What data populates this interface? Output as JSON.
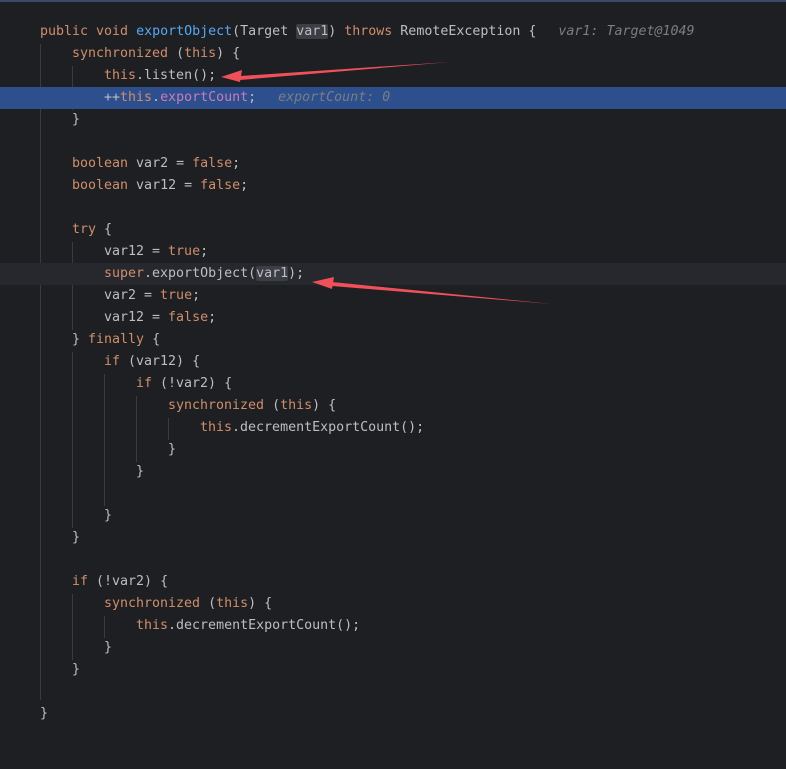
{
  "code": {
    "l1": {
      "kw1": "public void ",
      "method": "exportObject",
      "paren": "(Target ",
      "param": "var1",
      "paren2": ") ",
      "kw2": "throws",
      "rest": " RemoteException {",
      "hint": "var1: Target@1049"
    },
    "l2": {
      "kw": "synchronized",
      "rest": " (",
      "kw2": "this",
      "rest2": ") {"
    },
    "l3": {
      "kw": "this",
      "rest": ".listen();"
    },
    "l4": {
      "pre": "++",
      "kw": "this",
      "dot": ".",
      "field": "exportCount",
      "semi": ";",
      "hint": "exportCount: 0"
    },
    "l5": "}",
    "l7": {
      "kw": "boolean",
      "rest": " var2 = ",
      "kw2": "false",
      "semi": ";"
    },
    "l8": {
      "kw": "boolean",
      "rest": " var12 = ",
      "kw2": "false",
      "semi": ";"
    },
    "l10": {
      "kw": "try",
      "rest": " {"
    },
    "l11": {
      "rest": "var12 = ",
      "kw": "true",
      "semi": ";"
    },
    "l12": {
      "kw": "super",
      "rest": ".exportObject(",
      "param": "var1",
      "end": ");"
    },
    "l13": {
      "rest": "var2 = ",
      "kw": "true",
      "semi": ";"
    },
    "l14": {
      "rest": "var12 = ",
      "kw": "false",
      "semi": ";"
    },
    "l15": {
      "pre": "} ",
      "kw": "finally",
      "rest": " {"
    },
    "l16": {
      "kw": "if",
      "rest": " (var12) {"
    },
    "l17": {
      "kw": "if",
      "rest": " (!var2) {"
    },
    "l18": {
      "kw": "synchronized",
      "rest": " (",
      "kw2": "this",
      "rest2": ") {"
    },
    "l19": {
      "kw": "this",
      "rest": ".decrementExportCount();"
    },
    "l20": "}",
    "l21": "}",
    "l23": "}",
    "l24": "}",
    "l26": {
      "kw": "if",
      "rest": " (!var2) {"
    },
    "l27": {
      "kw": "synchronized",
      "rest": " (",
      "kw2": "this",
      "rest2": ") {"
    },
    "l28": {
      "kw": "this",
      "rest": ".decrementExportCount();"
    },
    "l29": "}",
    "l30": "}",
    "l32": "}"
  },
  "colors": {
    "background": "#1e1f22",
    "execution_line": "#2d4f8e",
    "keyword": "#cf8e6d",
    "method": "#56a8f5",
    "field": "#c77dbb",
    "annotation_arrow": "#f0505a"
  },
  "icons": [
    "red-arrow-annotation"
  ]
}
